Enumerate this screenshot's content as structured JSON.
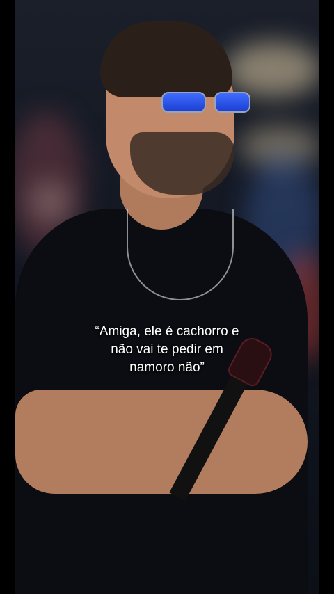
{
  "caption": {
    "line1": "“Amiga, ele é cachorro e",
    "line2": "não vai te pedir em",
    "line3": "namoro não”"
  }
}
